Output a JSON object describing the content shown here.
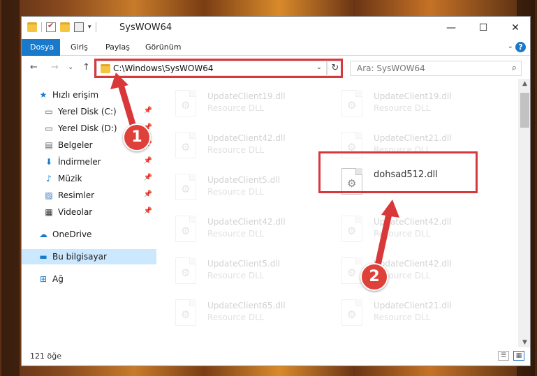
{
  "window": {
    "title": "SysWOW64",
    "controls": {
      "minimize": "—",
      "maximize": "☐",
      "close": "✕"
    }
  },
  "ribbon": {
    "tabs": [
      "Dosya",
      "Giriş",
      "Paylaş",
      "Görünüm"
    ],
    "active_tab": "Dosya",
    "accent_color": "#1979ca",
    "help": "?"
  },
  "navigation": {
    "back": "←",
    "forward": "→",
    "recent": "⌄",
    "up": "↑",
    "address_path": "C:\\Windows\\SysWOW64",
    "search_placeholder": "Ara: SysWOW64"
  },
  "sidebar": {
    "items": [
      {
        "label": "Hızlı erişim",
        "icon": "star-icon",
        "pinned": false,
        "selected": false
      },
      {
        "label": "Yerel Disk (C:)",
        "icon": "drive-icon",
        "pinned": true,
        "selected": false
      },
      {
        "label": "Yerel Disk (D:)",
        "icon": "drive-icon",
        "pinned": true,
        "selected": false
      },
      {
        "label": "Belgeler",
        "icon": "documents-icon",
        "pinned": true,
        "selected": false
      },
      {
        "label": "İndirmeler",
        "icon": "download-icon",
        "pinned": true,
        "selected": false
      },
      {
        "label": "Müzik",
        "icon": "music-icon",
        "pinned": true,
        "selected": false
      },
      {
        "label": "Resimler",
        "icon": "pictures-icon",
        "pinned": true,
        "selected": false
      },
      {
        "label": "Videolar",
        "icon": "video-icon",
        "pinned": true,
        "selected": false
      },
      {
        "label": "OneDrive",
        "icon": "cloud-icon",
        "pinned": false,
        "selected": false
      },
      {
        "label": "Bu bilgisayar",
        "icon": "computer-icon",
        "pinned": false,
        "selected": true
      },
      {
        "label": "Ağ",
        "icon": "network-icon",
        "pinned": false,
        "selected": false
      }
    ]
  },
  "files": {
    "left_column": [
      {
        "name": "UpdateClient19.dll",
        "type": "Resource DLL"
      },
      {
        "name": "UpdateClient42.dll",
        "type": "Resource DLL"
      },
      {
        "name": "UpdateClient5.dll",
        "type": "Resource DLL"
      },
      {
        "name": "UpdateClient42.dll",
        "type": "Resource DLL"
      },
      {
        "name": "UpdateClient5.dll",
        "type": "Resource DLL"
      },
      {
        "name": "UpdateClient65.dll",
        "type": "Resource DLL"
      }
    ],
    "right_column": [
      {
        "name": "UpdateClient19.dll",
        "type": "Resource DLL"
      },
      {
        "name": "UpdateClient21.dll",
        "type": "Resource DLL"
      },
      {
        "name": "dohsad512.dll",
        "type": ""
      },
      {
        "name": "UpdateClient42.dll",
        "type": "Resource DLL"
      },
      {
        "name": "UpdateClient42.dll",
        "type": "Resource DLL"
      },
      {
        "name": "UpdateClient21.dll",
        "type": "Resource DLL"
      }
    ],
    "highlighted_file": "dohsad512.dll"
  },
  "status": {
    "item_count": "121 öğe"
  },
  "annotations": {
    "marker_1": "1",
    "marker_2": "2",
    "highlight_color": "#d9383a"
  }
}
